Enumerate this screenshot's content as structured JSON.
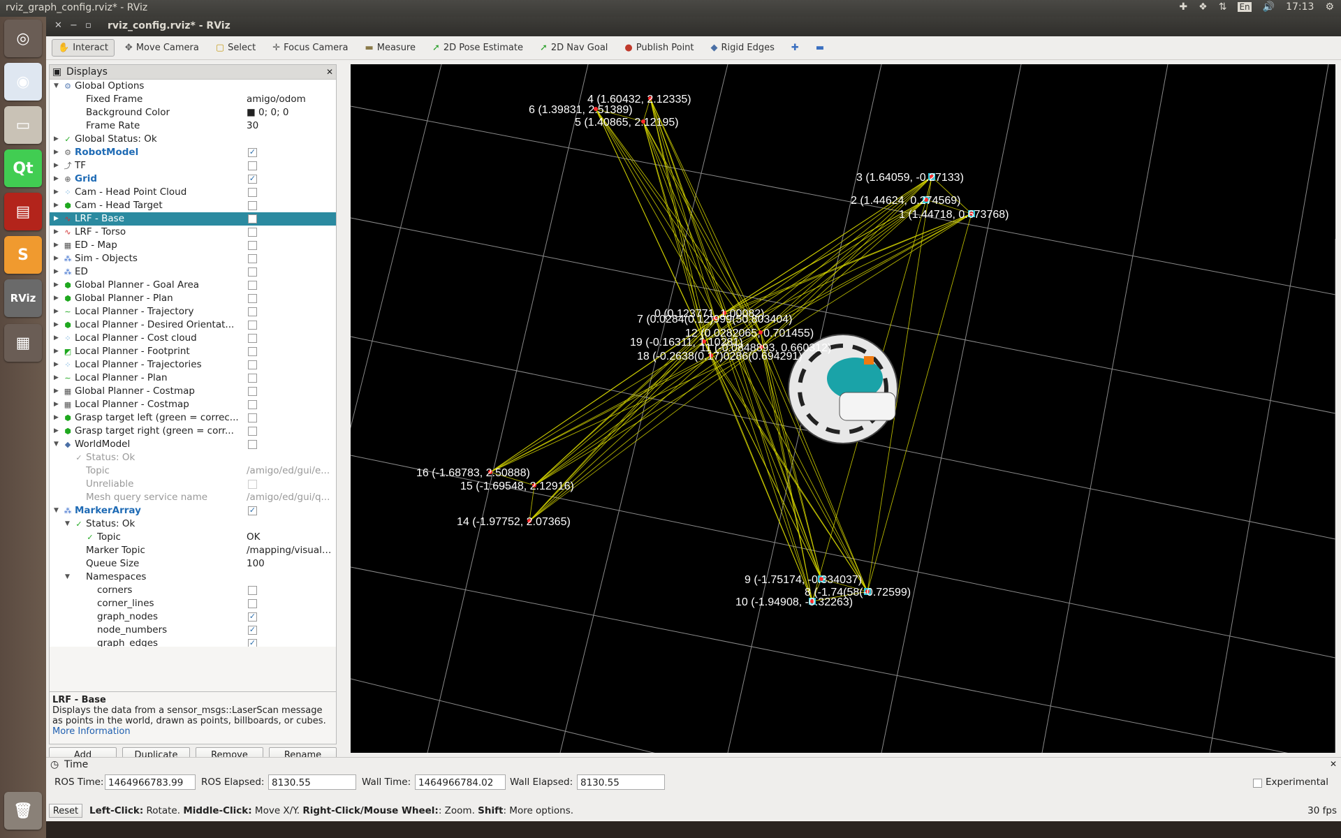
{
  "top_panel": {
    "title": "rviz_graph_config.rviz* - RViz",
    "clock": "17:13",
    "keyboard": "En"
  },
  "launcher": {
    "items": [
      {
        "name": "ubuntu-dash",
        "glyph": "◎",
        "color": "#6a5d55"
      },
      {
        "name": "chrome",
        "glyph": "◉",
        "color": "#dfe7f1"
      },
      {
        "name": "files",
        "glyph": "▭",
        "color": "#c9c2b6"
      },
      {
        "name": "qt-creator",
        "glyph": "Qt",
        "color": "#41cd52"
      },
      {
        "name": "system-monitor",
        "glyph": "▤",
        "color": "#b3241b"
      },
      {
        "name": "sublime-text",
        "glyph": "S",
        "color": "#f09a2f"
      },
      {
        "name": "rviz",
        "glyph": "RViz",
        "color": "#6a6a6a"
      },
      {
        "name": "workspace-switcher",
        "glyph": "▦",
        "color": "#6a5d55"
      },
      {
        "name": "trash",
        "glyph": "🗑",
        "color": "#8a8178"
      }
    ]
  },
  "window": {
    "title": "rviz_config.rviz* - RViz"
  },
  "toolbar": {
    "items": [
      {
        "label": "Interact",
        "icon": "✋",
        "color": "#555"
      },
      {
        "label": "Move Camera",
        "icon": "✥",
        "color": "#555"
      },
      {
        "label": "Select",
        "icon": "▢",
        "color": "#c9a227"
      },
      {
        "label": "Focus Camera",
        "icon": "✛",
        "color": "#555"
      },
      {
        "label": "Measure",
        "icon": "▬",
        "color": "#8a7a4a"
      },
      {
        "label": "2D Pose Estimate",
        "icon": "➚",
        "color": "#2aa02a"
      },
      {
        "label": "2D Nav Goal",
        "icon": "➚",
        "color": "#2aa02a"
      },
      {
        "label": "Publish Point",
        "icon": "●",
        "color": "#c0392b"
      },
      {
        "label": "Rigid Edges",
        "icon": "◆",
        "color": "#4a6fa5"
      }
    ],
    "plus_icon": "✚",
    "minus_icon": "▬"
  },
  "displays": {
    "title": "Displays",
    "rows": [
      {
        "label": "Global Options",
        "level": 0,
        "arrow": "▼",
        "icon": "⚙",
        "icon_color": "#5a7fb5"
      },
      {
        "label": "Fixed Frame",
        "level": 1,
        "value": "amigo/odom"
      },
      {
        "label": "Background Color",
        "level": 1,
        "value": "■ 0; 0; 0"
      },
      {
        "label": "Frame Rate",
        "level": 1,
        "value": "30"
      },
      {
        "label": "Global Status: Ok",
        "level": 0,
        "arrow": "▶",
        "icon": "✓",
        "icon_color": "#2a2"
      },
      {
        "label": "RobotModel",
        "level": 0,
        "arrow": "▶",
        "icon": "⚙",
        "icon_color": "#666",
        "blue": true,
        "check": true
      },
      {
        "label": "TF",
        "level": 0,
        "arrow": "▶",
        "icon": "⤴",
        "icon_color": "#555",
        "check": false
      },
      {
        "label": "Grid",
        "level": 0,
        "arrow": "▶",
        "icon": "⊕",
        "icon_color": "#555",
        "blue": true,
        "check": true
      },
      {
        "label": "Cam - Head Point Cloud",
        "level": 0,
        "arrow": "▶",
        "icon": "⁘",
        "icon_color": "#3a8fd0",
        "check": false
      },
      {
        "label": "Cam - Head Target",
        "level": 0,
        "arrow": "▶",
        "icon": "⬢",
        "icon_color": "#1fa81f",
        "check": false
      },
      {
        "label": "LRF - Base",
        "level": 0,
        "arrow": "▶",
        "icon": "∿",
        "icon_color": "#d03030",
        "check": false,
        "selected": true
      },
      {
        "label": "LRF - Torso",
        "level": 0,
        "arrow": "▶",
        "icon": "∿",
        "icon_color": "#d03030",
        "check": false
      },
      {
        "label": "ED - Map",
        "level": 0,
        "arrow": "▶",
        "icon": "▦",
        "icon_color": "#555",
        "check": false
      },
      {
        "label": "Sim - Objects",
        "level": 0,
        "arrow": "▶",
        "icon": "⁂",
        "icon_color": "#2a62c9",
        "check": false
      },
      {
        "label": "ED",
        "level": 0,
        "arrow": "▶",
        "icon": "⁂",
        "icon_color": "#2a62c9",
        "check": false
      },
      {
        "label": "Global Planner - Goal Area",
        "level": 0,
        "arrow": "▶",
        "icon": "⬢",
        "icon_color": "#1fa81f",
        "check": false
      },
      {
        "label": "Global Planner - Plan",
        "level": 0,
        "arrow": "▶",
        "icon": "⬢",
        "icon_color": "#1fa81f",
        "check": false
      },
      {
        "label": "Local Planner - Trajectory",
        "level": 0,
        "arrow": "▶",
        "icon": "∼",
        "icon_color": "#1fa81f",
        "check": false
      },
      {
        "label": "Local Planner - Desired Orientat...",
        "level": 0,
        "arrow": "▶",
        "icon": "⬢",
        "icon_color": "#1fa81f",
        "check": false
      },
      {
        "label": "Local Planner - Cost cloud",
        "level": 0,
        "arrow": "▶",
        "icon": "⁘",
        "icon_color": "#3a8fd0",
        "check": false
      },
      {
        "label": "Local Planner - Footprint",
        "level": 0,
        "arrow": "▶",
        "icon": "◩",
        "icon_color": "#1fa81f",
        "check": false
      },
      {
        "label": "Local Planner - Trajectories",
        "level": 0,
        "arrow": "▶",
        "icon": "⁘",
        "icon_color": "#3a8fd0",
        "check": false
      },
      {
        "label": "Local Planner - Plan",
        "level": 0,
        "arrow": "▶",
        "icon": "∼",
        "icon_color": "#1fa81f",
        "check": false
      },
      {
        "label": "Global Planner - Costmap",
        "level": 0,
        "arrow": "▶",
        "icon": "▦",
        "icon_color": "#555",
        "check": false
      },
      {
        "label": "Local Planner - Costmap",
        "level": 0,
        "arrow": "▶",
        "icon": "▦",
        "icon_color": "#555",
        "check": false
      },
      {
        "label": "Grasp target left (green = correc...",
        "level": 0,
        "arrow": "▶",
        "icon": "⬢",
        "icon_color": "#1fa81f",
        "check": false
      },
      {
        "label": "Grasp target right (green = corr...",
        "level": 0,
        "arrow": "▶",
        "icon": "⬢",
        "icon_color": "#1fa81f",
        "check": false
      },
      {
        "label": "WorldModel",
        "level": 0,
        "arrow": "▼",
        "icon": "◆",
        "icon_color": "#4a6fa5",
        "check": false
      },
      {
        "label": "Status: Ok",
        "level": 1,
        "icon": "✓",
        "icon_color": "#999",
        "gray": true
      },
      {
        "label": "Topic",
        "level": 1,
        "gray": true,
        "value": "/amigo/ed/gui/e...",
        "value_gray": true
      },
      {
        "label": "Unreliable",
        "level": 1,
        "gray": true,
        "check": false
      },
      {
        "label": "Mesh query service name",
        "level": 1,
        "gray": true,
        "value": "/amigo/ed/gui/q...",
        "value_gray": true
      },
      {
        "label": "MarkerArray",
        "level": 0,
        "arrow": "▼",
        "icon": "⁂",
        "icon_color": "#2a62c9",
        "blue": true,
        "check": true
      },
      {
        "label": "Status: Ok",
        "level": 1,
        "arrow": "▼",
        "icon": "✓",
        "icon_color": "#2a2"
      },
      {
        "label": "Topic",
        "level": 2,
        "icon": "✓",
        "icon_color": "#2a2",
        "value": "OK"
      },
      {
        "label": "Marker Topic",
        "level": 1,
        "value": "/mapping/visuali..."
      },
      {
        "label": "Queue Size",
        "level": 1,
        "value": "100"
      },
      {
        "label": "Namespaces",
        "level": 1,
        "arrow": "▼"
      },
      {
        "label": "corners",
        "level": 2,
        "check": false
      },
      {
        "label": "corner_lines",
        "level": 2,
        "check": false
      },
      {
        "label": "graph_nodes",
        "level": 2,
        "check": true
      },
      {
        "label": "node_numbers",
        "level": 2,
        "check": true
      },
      {
        "label": "graph_edges",
        "level": 2,
        "check": true
      }
    ],
    "description_title": "LRF - Base",
    "description_text": "Displays the data from a sensor_msgs::LaserScan message as points in the world, drawn as points, billboards, or cubes.",
    "more_info": "More Information",
    "buttons": [
      "Add",
      "Duplicate",
      "Remove",
      "Rename"
    ]
  },
  "graph": {
    "nodes": [
      {
        "label": "4  (1.60432, 2.12335)"
      },
      {
        "label": "6  (1.39831, 2.51389)"
      },
      {
        "label": "5  (1.40865, 2.12195)"
      },
      {
        "label": "3  (1.64059, -0.27133)"
      },
      {
        "label": "2  (1.44624, 0.274569)"
      },
      {
        "label": "1  (1.44718, 0.673768)"
      },
      {
        "label": "0  (0.123771, 1.00082)"
      },
      {
        "label": "7  (0.0284(0.12)999(50.803404)"
      },
      {
        "label": "12  (0.0282065, 0.701455)"
      },
      {
        "label": "19  (-0.16311, 1.10281)"
      },
      {
        "label": "11  (-0.0848893, 0.660312)"
      },
      {
        "label": "18  (-0.2638(0.17)0286(0.694291)"
      },
      {
        "label": "16  (-1.68783, 2.50888)"
      },
      {
        "label": "15  (-1.69548, 2.12916)"
      },
      {
        "label": "14  (-1.97752, 2.07365)"
      },
      {
        "label": "9  (-1.75174, -0.334037)"
      },
      {
        "label": "8  (-1.74(58(-0.72599)"
      },
      {
        "label": "10  (-1.94908, -0.32263)"
      }
    ]
  },
  "time": {
    "title": "Time",
    "ros_time_label": "ROS Time:",
    "ros_time": "1464966783.99",
    "ros_elapsed_label": "ROS Elapsed:",
    "ros_elapsed": "8130.55",
    "wall_time_label": "Wall Time:",
    "wall_time": "1464966784.02",
    "wall_elapsed_label": "Wall Elapsed:",
    "wall_elapsed": "8130.55",
    "experimental_label": "Experimental"
  },
  "status": {
    "reset_label": "Reset",
    "hint_b1": "Left-Click:",
    "hint_t1": " Rotate. ",
    "hint_b2": "Middle-Click:",
    "hint_t2": " Move X/Y. ",
    "hint_b3": "Right-Click/Mouse Wheel:",
    "hint_t3": ": Zoom. ",
    "hint_b4": "Shift",
    "hint_t4": ": More options.",
    "fps": "30 fps"
  }
}
